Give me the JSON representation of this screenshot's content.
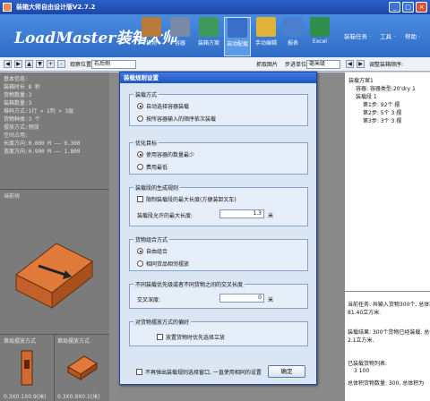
{
  "window": {
    "title": "装箱大师自由设计版V2.7.2",
    "minimize": "_",
    "maximize": "□",
    "close": "×"
  },
  "header": {
    "logo_text": "LoadMaster装箱大师",
    "tools": [
      {
        "label": "货物",
        "icon": "box-icon",
        "color": "#b87a3a"
      },
      {
        "label": "容器",
        "icon": "container-icon",
        "color": "#7a8aa6"
      },
      {
        "label": "装箱方案",
        "icon": "plan-icon",
        "color": "#3e9a5c"
      },
      {
        "label": "自动配载",
        "icon": "auto-load-icon",
        "color": "#3a6fc9"
      },
      {
        "label": "手动编辑",
        "icon": "hand-edit-icon",
        "color": "#e0b23a"
      },
      {
        "label": "报表",
        "icon": "report-icon",
        "color": "#4a7fd0"
      },
      {
        "label": "Excel",
        "icon": "excel-icon",
        "color": "#2f8f4a"
      }
    ],
    "menus": [
      "装箱任务 ·",
      "工具 ·",
      "帮助 ·"
    ]
  },
  "toolbar": {
    "view_label": "观察位置",
    "view_value": "右后侧",
    "capture_label": "抓取图片",
    "step_label": "步进单位",
    "step_value": "毫米级",
    "adjust_label": "调整装箱顺序:"
  },
  "left_panel": {
    "lines": [
      "基本信息:",
      "装箱时长 8 秒",
      "货物数量:3",
      "装箱数量:3",
      "堆码方式:1行 × 1列 × 3层",
      "货物种类:3 个",
      "摆放方式:侧放",
      "",
      "空间占用:",
      "长度方向:0.000 M —— 0.300",
      "",
      "宽度方向:0.900 M —— 1.800"
    ],
    "current_caption": "当前块",
    "pattern1_caption": "第局摆放方式",
    "pattern2_caption": "第局摆放方式",
    "pattern1_dims": "0.3X0.1X0.9(米)",
    "pattern2_dims": "0.3X0.9X0.1(米)"
  },
  "right_panel": {
    "tree": [
      "装载方案1",
      "容器:   容器类型:20'dry   1",
      "装载段 1",
      "第1步:  92个   摆",
      "第2步:  5个 3   摆",
      "第3步:  3个 3   摆"
    ],
    "info": [
      "当前任务: 共输入货物300个, 总体积为",
      "81.40立方米.",
      "",
      "装载结果: 300个货物已经装载. 总体积为",
      "2.1立方米.",
      "",
      "已装载货物列表:",
      "3    100",
      "总体积货物数量: 300,  总体积为"
    ]
  },
  "dialog": {
    "title": "装载规则设置",
    "load_mode": {
      "label": "装载方式",
      "options": [
        "自动选择容器装载",
        "按所容器输入的顺序依次装载"
      ],
      "selected": 0
    },
    "optimize": {
      "label": "优化目标",
      "options": [
        "使用容器的数量最少",
        "费用最低"
      ],
      "selected": 0
    },
    "placement_rule": {
      "label": "装载段的生成规则",
      "limit_label": "限制装载段的最大长度(方便装卸叉车)",
      "max_len_label": "装载段允许的最大长度:",
      "max_len_value": "1.3",
      "unit": "米"
    },
    "cargo_combo": {
      "label": "货物组合方式",
      "options": [
        "自由组合",
        "相同货品相邻摆放"
      ],
      "selected": 0
    },
    "overlap": {
      "label": "不同装载优先级或者不同货物之间的交叉长度",
      "field_label": "交叉深度:",
      "value": "0",
      "unit": "米"
    },
    "preference": {
      "label": "对货物摆放方式的偏好",
      "option": "放置货物时优先选择立放"
    },
    "footer_check": "不再弹出装载规则选择窗口, 一直使用相同的设置",
    "ok_label": "确定"
  }
}
